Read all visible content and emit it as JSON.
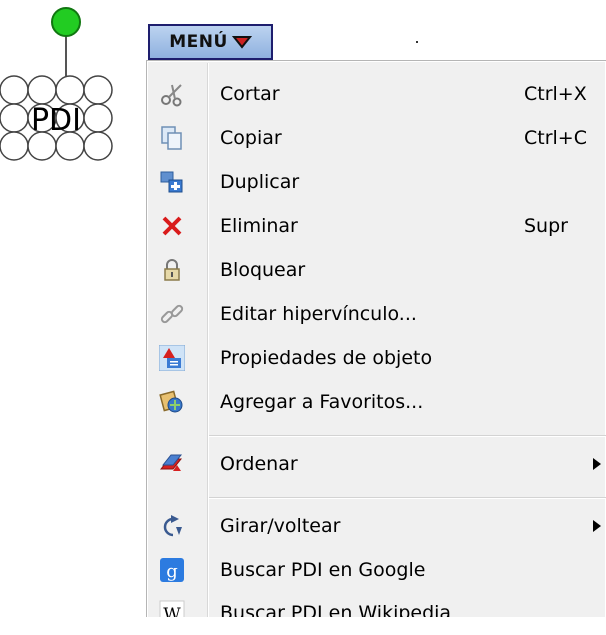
{
  "shape": {
    "label": "PDI",
    "connector_color": "#22cc22"
  },
  "menu_button": {
    "label": "MENÚ",
    "icon": "triangle-down-icon"
  },
  "menu": {
    "items": [
      {
        "label": "Cortar",
        "shortcut": "Ctrl+X",
        "icon": "scissors-icon"
      },
      {
        "label": "Copiar",
        "shortcut": "Ctrl+C",
        "icon": "copy-icon"
      },
      {
        "label": "Duplicar",
        "shortcut": "",
        "icon": "duplicate-icon"
      },
      {
        "label": "Eliminar",
        "shortcut": "Supr",
        "icon": "delete-x-icon"
      },
      {
        "label": "Bloquear",
        "shortcut": "",
        "icon": "lock-icon"
      },
      {
        "label": "Editar hipervínculo...",
        "shortcut": "",
        "icon": "link-icon"
      },
      {
        "label": "Propiedades de objeto",
        "shortcut": "",
        "icon": "properties-icon"
      },
      {
        "label": "Agregar a Favoritos...",
        "shortcut": "",
        "icon": "favorites-icon"
      },
      {
        "label": "Ordenar",
        "shortcut": "",
        "icon": "order-icon",
        "submenu": true
      },
      {
        "label": "Girar/voltear",
        "shortcut": "",
        "icon": "rotate-icon",
        "submenu": true
      },
      {
        "label": "Buscar PDI en Google",
        "shortcut": "",
        "icon": "google-icon"
      },
      {
        "label": "Buscar PDI en Wikipedia",
        "shortcut": "",
        "icon": "wikipedia-icon"
      }
    ]
  }
}
